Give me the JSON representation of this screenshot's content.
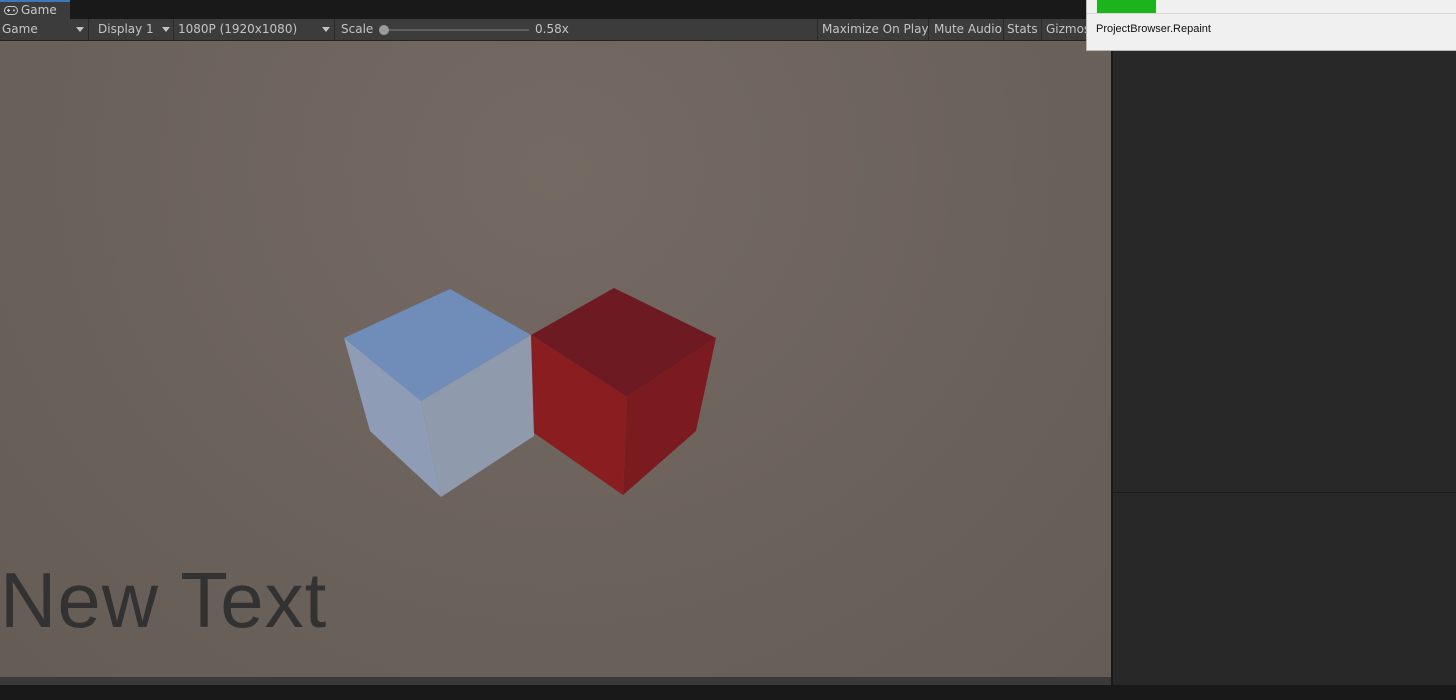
{
  "tabs": {
    "game_tab_label": "Game",
    "game_tab_icon": "gamepad-icon"
  },
  "toolbar": {
    "view_select": "Game",
    "display_select": "Display 1",
    "resolution_select": "1080P (1920x1080)",
    "scale_label": "Scale",
    "scale_value": "0.58x",
    "scale_fraction": 0.0,
    "maximize_on_play": "Maximize On Play",
    "mute_audio": "Mute Audio",
    "stats": "Stats",
    "gizmos": "Gizmos"
  },
  "viewport": {
    "ui_text": "New Text",
    "cubes": [
      {
        "name": "blue cube",
        "color": "#7e93b9"
      },
      {
        "name": "red cube",
        "color": "#8c1c1f"
      }
    ]
  },
  "progress_popup": {
    "message": "ProjectBrowser.Repaint",
    "progress_color": "#1cb41c",
    "progress_fraction": 0.16
  },
  "colors": {
    "accent": "#3a79bb",
    "viewport_bg": "#6b615b"
  }
}
